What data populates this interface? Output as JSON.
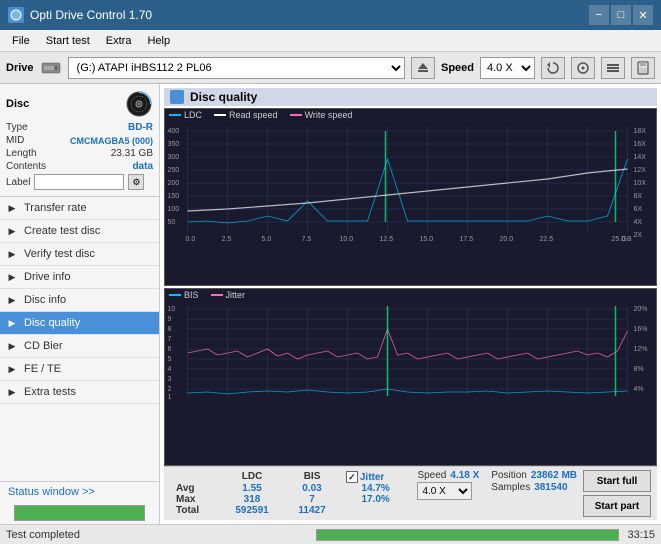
{
  "titlebar": {
    "title": "Opti Drive Control 1.70",
    "min_btn": "−",
    "max_btn": "□",
    "close_btn": "✕"
  },
  "menubar": {
    "items": [
      "File",
      "Start test",
      "Extra",
      "Help"
    ]
  },
  "drivebar": {
    "label": "Drive",
    "drive_value": "(G:)  ATAPI iHBS112  2 PL06",
    "speed_label": "Speed",
    "speed_value": "4.0 X"
  },
  "disc": {
    "title": "Disc",
    "type_label": "Type",
    "type_val": "BD-R",
    "mid_label": "MID",
    "mid_val": "CMCMAGBA5 (000)",
    "length_label": "Length",
    "length_val": "23.31 GB",
    "contents_label": "Contents",
    "contents_val": "data",
    "label_label": "Label"
  },
  "nav": {
    "items": [
      {
        "id": "transfer-rate",
        "label": "Transfer rate",
        "active": false
      },
      {
        "id": "create-test-disc",
        "label": "Create test disc",
        "active": false
      },
      {
        "id": "verify-test-disc",
        "label": "Verify test disc",
        "active": false
      },
      {
        "id": "drive-info",
        "label": "Drive info",
        "active": false
      },
      {
        "id": "disc-info",
        "label": "Disc info",
        "active": false
      },
      {
        "id": "disc-quality",
        "label": "Disc quality",
        "active": true
      },
      {
        "id": "cd-bier",
        "label": "CD Bier",
        "active": false
      },
      {
        "id": "fe-te",
        "label": "FE / TE",
        "active": false
      },
      {
        "id": "extra-tests",
        "label": "Extra tests",
        "active": false
      }
    ]
  },
  "chart": {
    "title": "Disc quality",
    "legend1": {
      "ldc": "LDC",
      "read_speed": "Read speed",
      "write_speed": "Write speed"
    },
    "legend2": {
      "bis": "BIS",
      "jitter": "Jitter"
    },
    "x_labels": [
      "0.0",
      "2.5",
      "5.0",
      "7.5",
      "10.0",
      "12.5",
      "15.0",
      "17.5",
      "20.0",
      "22.5",
      "25.0"
    ],
    "y1_labels_left": [
      "400",
      "350",
      "300",
      "250",
      "200",
      "150",
      "100",
      "50"
    ],
    "y1_labels_right": [
      "18X",
      "16X",
      "14X",
      "12X",
      "10X",
      "8X",
      "6X",
      "4X",
      "2X"
    ],
    "y2_labels_left": [
      "10",
      "9",
      "8",
      "7",
      "6",
      "5",
      "4",
      "3",
      "2",
      "1"
    ],
    "y2_labels_right": [
      "20%",
      "16%",
      "12%",
      "8%",
      "4%"
    ],
    "x_unit": "GB"
  },
  "stats": {
    "col_ldc": "LDC",
    "col_bis": "BIS",
    "col_jitter": "Jitter",
    "col_speed": "Speed",
    "row_avg": "Avg",
    "row_max": "Max",
    "row_total": "Total",
    "avg_ldc": "1.55",
    "avg_bis": "0.03",
    "avg_jitter": "14.7%",
    "max_ldc": "318",
    "max_bis": "7",
    "max_jitter": "17.0%",
    "total_ldc": "592591",
    "total_bis": "11427",
    "speed_val": "4.18 X",
    "speed_select": "4.0 X",
    "position_label": "Position",
    "position_val": "23862 MB",
    "samples_label": "Samples",
    "samples_val": "381540",
    "btn_start_full": "Start full",
    "btn_start_part": "Start part"
  },
  "statusbar": {
    "status_text": "Test completed",
    "progress": 100,
    "time": "33:15"
  },
  "colors": {
    "ldc": "#00bfff",
    "read_speed": "#ffffff",
    "write_speed": "#ff69b4",
    "bis": "#00bfff",
    "jitter": "#ff69b4",
    "grid_green": "#00aa00",
    "accent": "#4a90d9"
  }
}
